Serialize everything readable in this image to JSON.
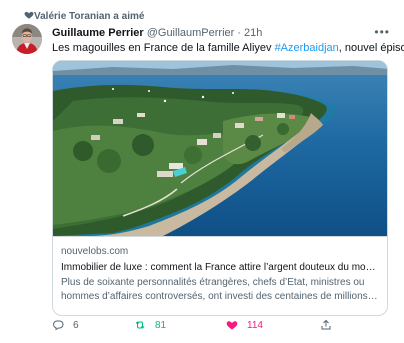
{
  "social_context": "Valérie Toranian a aimé",
  "author": {
    "name": "Guillaume Perrier",
    "handle": "@GuillaumPerrier",
    "separator": "·",
    "time": "21h"
  },
  "tweet": {
    "text_before": "Les magouilles en France de la famille Aliyev ",
    "hashtag": "#Azerbaidjan",
    "text_after": ", nouvel épisode."
  },
  "card": {
    "domain": "nouvelobs.com",
    "title": "Immobilier de luxe : comment la France attire l’argent douteux du mon…",
    "description_line1": "Plus de soixante personnalités étrangères, chefs d’Etat, ministres ou",
    "description_line2": "hommes d’affaires controversés, ont investi des centaines de millions…"
  },
  "actions": {
    "reply_count": "6",
    "retweet_count": "81",
    "like_count": "114"
  },
  "colors": {
    "accent": "#1d9bf0",
    "retweet": "#00ba7c",
    "like": "#f91880",
    "secondary_text": "#536471"
  },
  "icons": [
    "heart-icon",
    "more-icon",
    "reply-icon",
    "retweet-icon",
    "like-icon",
    "share-icon"
  ]
}
